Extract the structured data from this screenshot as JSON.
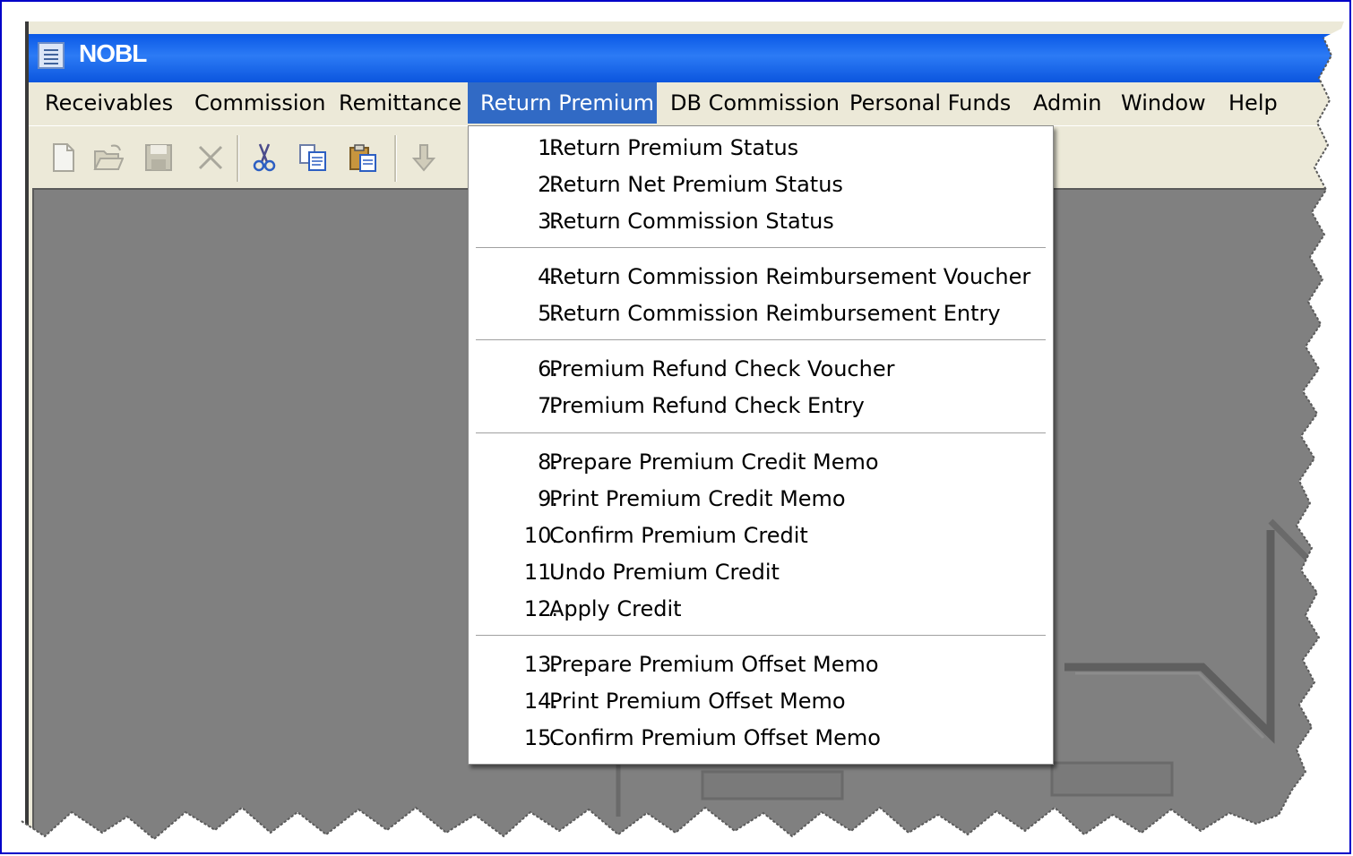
{
  "window": {
    "title": "NOBL",
    "icon": "app-window-icon"
  },
  "menubar": {
    "items": [
      {
        "label": "Receivables"
      },
      {
        "label": "Commission"
      },
      {
        "label": "Remittance"
      },
      {
        "label": "Return Premium",
        "active": true
      },
      {
        "label": "DB Commission"
      },
      {
        "label": "Personal Funds"
      },
      {
        "label": "Admin"
      },
      {
        "label": "Window"
      },
      {
        "label": "Help"
      }
    ]
  },
  "toolbar": {
    "icons": [
      "new-document-icon",
      "open-folder-icon",
      "save-disk-icon",
      "delete-x-icon",
      "cut-scissors-icon",
      "copy-icon",
      "paste-icon",
      "down-arrow-icon"
    ]
  },
  "dropdown": {
    "items": [
      {
        "num": "1.",
        "label": "Return Premium Status"
      },
      {
        "num": "2.",
        "label": "Return Net Premium Status"
      },
      {
        "num": "3.",
        "label": "Return Commission Status"
      },
      {
        "num": "4.",
        "label": "Return Commission Reimbursement Voucher"
      },
      {
        "num": "5.",
        "label": "Return Commission Reimbursement Entry"
      },
      {
        "num": "6.",
        "label": "Premium Refund Check Voucher"
      },
      {
        "num": "7.",
        "label": "Premium Refund Check Entry"
      },
      {
        "num": "8.",
        "label": "Prepare Premium Credit Memo"
      },
      {
        "num": "9.",
        "label": "Print Premium Credit Memo"
      },
      {
        "num": "10.",
        "label": "Confirm Premium Credit"
      },
      {
        "num": "11.",
        "label": "Undo Premium Credit"
      },
      {
        "num": "12.",
        "label": "Apply Credit"
      },
      {
        "num": "13.",
        "label": "Prepare Premium Offset Memo"
      },
      {
        "num": "14.",
        "label": "Print Premium Offset Memo"
      },
      {
        "num": "15.",
        "label": "Confirm Premium Offset Memo"
      }
    ]
  },
  "colors": {
    "title_bar": "#0a58e6",
    "menu_highlight": "#316ac5",
    "workspace": "#808080",
    "frame_border": "#0000c8"
  }
}
